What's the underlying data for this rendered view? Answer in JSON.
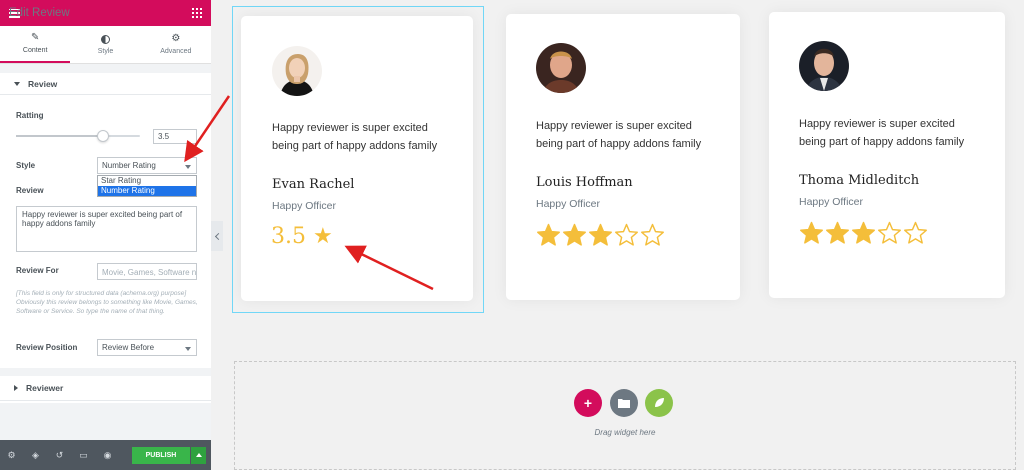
{
  "sidebar": {
    "header_title": "Edit Review",
    "tabs": [
      {
        "label": "Content",
        "icon": "pencil-icon"
      },
      {
        "label": "Style",
        "icon": "half-circle-icon"
      },
      {
        "label": "Advanced",
        "icon": "gear-icon"
      }
    ],
    "section_review": "Review",
    "rating_label": "Ratting",
    "rating_value": "3.5",
    "rating_slider_fraction": 0.7,
    "style_label": "Style",
    "style_selected": "Number Rating",
    "style_options": [
      "Star Rating",
      "Number Rating"
    ],
    "review_label": "Review",
    "review_text": "Happy reviewer is super excited being part of happy addons family",
    "review_for_label": "Review For",
    "review_for_placeholder": "Movie, Games, Software name",
    "help_text": "[This field is only for structured data (achema.org) purpose] Obviously this review belongs to something like Movie, Games, Software or Service. So type the name of that thing.",
    "review_position_label": "Review Position",
    "review_position_value": "Review Before",
    "section_reviewer": "Reviewer",
    "publish_label": "PUBLISH"
  },
  "cards": [
    {
      "review": "Happy reviewer is super excited being part of happy addons family",
      "name": "Evan Rachel",
      "title": "Happy Officer",
      "rating_display": "number",
      "rating": "3.5"
    },
    {
      "review": "Happy reviewer is super excited being part of happy addons family",
      "name": "Louis Hoffman",
      "title": "Happy Officer",
      "rating_display": "stars",
      "rating": 3.5
    },
    {
      "review": "Happy reviewer is super excited being part of happy addons family",
      "name": "Thoma Midleditch",
      "title": "Happy Officer",
      "rating_display": "stars",
      "rating": 3.5
    }
  ],
  "drop_area": {
    "label": "Drag widget here"
  },
  "colors": {
    "brand": "#d30c5c",
    "star": "#f4be3a",
    "publish": "#39b54a",
    "annotation_arrow": "#e02020"
  }
}
